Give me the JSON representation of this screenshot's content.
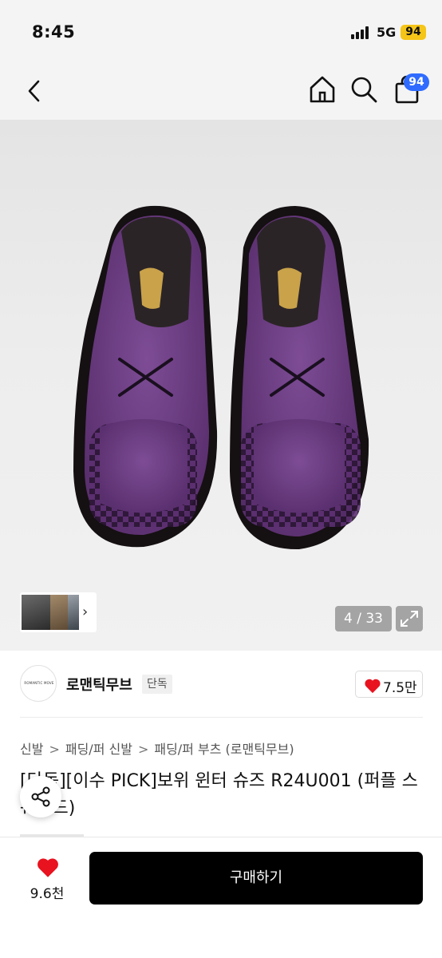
{
  "status_bar": {
    "time": "8:45",
    "network": "5G",
    "battery": "94"
  },
  "nav": {
    "cart_count": "94"
  },
  "gallery": {
    "counter": "4 / 33"
  },
  "brand": {
    "logo_text": "ROMANTIC MOVE",
    "name": "로맨틱무브",
    "tag": "단독",
    "likes": "7.5만"
  },
  "breadcrumb": [
    "신발",
    "패딩/퍼 신발",
    "패딩/퍼 부츠 (로맨틱무브)"
  ],
  "product": {
    "title": "[단독][이수 PICK]보위 윈터 슈즈 R24U001 (퍼플 스웨이드)"
  },
  "bottom": {
    "wish_count": "9.6천",
    "buy_label": "구매하기"
  },
  "colors": {
    "accent_blue": "#2f6bff",
    "battery_yellow": "#f5c518",
    "heart_red": "#e8131f",
    "shoe_purple": "#6e3f86"
  }
}
